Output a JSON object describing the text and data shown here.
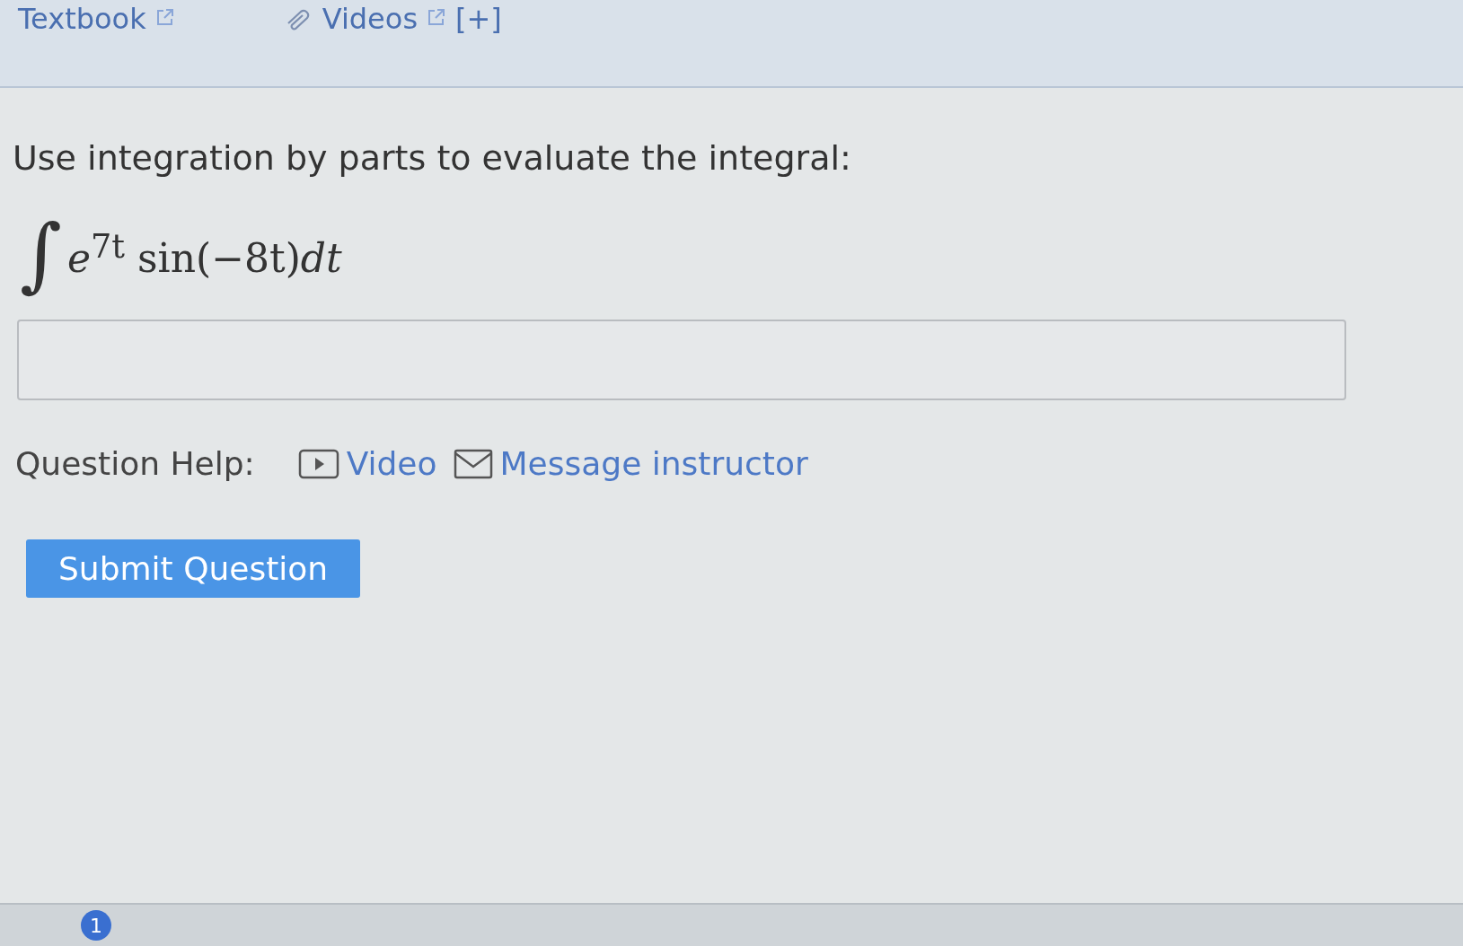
{
  "top_bar": {
    "textbook_link": "Textbook",
    "videos_link": "Videos",
    "expand_toggle": "[+]"
  },
  "question": {
    "prompt": "Use integration by parts to evaluate the integral:",
    "integral_sign": "∫",
    "base": "e",
    "exponent": "7t",
    "function": "sin(−8t)",
    "differential": "dt"
  },
  "question_help": {
    "label": "Question Help:",
    "links": [
      {
        "kind": "video",
        "label": "Video"
      },
      {
        "kind": "message",
        "label": "Message instructor"
      }
    ]
  },
  "submit_button": "Submit Question",
  "taskbar": {
    "badge": "1"
  }
}
